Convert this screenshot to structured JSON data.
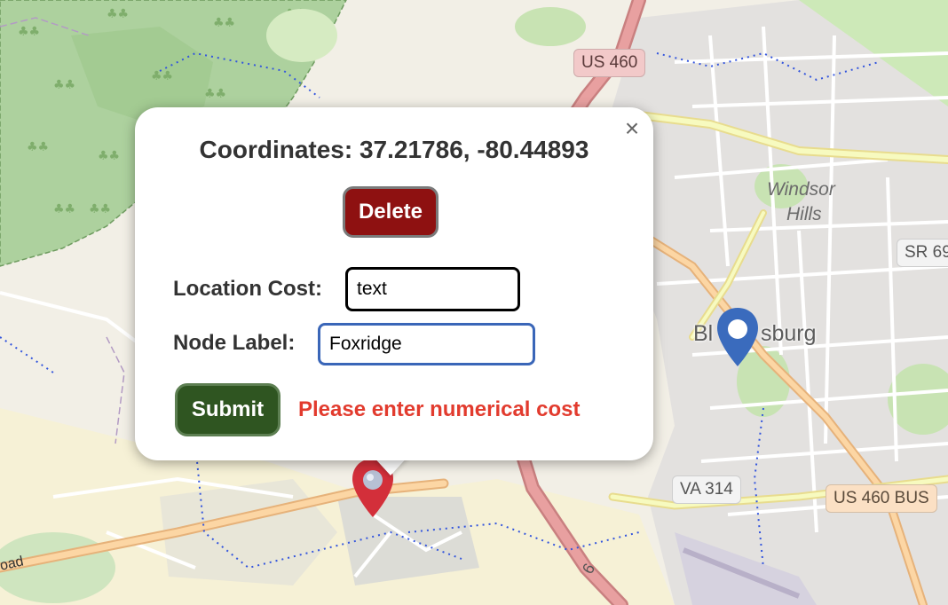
{
  "map": {
    "place_labels": {
      "windsor_hills_line1": "Windsor",
      "windsor_hills_line2": "Hills",
      "town_partial": "Bl",
      "town_partial2": "sburg",
      "road_fragment": "oad",
      "route_six": "6"
    },
    "shields": {
      "us460": "US 460",
      "sr": "SR 69",
      "va314": "VA 314",
      "us460bus": "US 460 BUS"
    },
    "colors": {
      "forest": "#add19e",
      "forest_border": "#6e9b5f",
      "urban": "#e0dfdf",
      "road_primary": "#fcd6a4",
      "road_trunk": "#e8a0a0",
      "road_minor": "#ffffff",
      "trail": "#3355dd",
      "marker_blue": "#3a6bbd",
      "marker_red": "#d32f3a"
    }
  },
  "popup": {
    "coordinates_text": "Coordinates: 37.21786, -80.44893",
    "close_symbol": "×",
    "delete_label": "Delete",
    "location_cost_label": "Location Cost:",
    "location_cost_value": "text",
    "node_label_label": "Node Label:",
    "node_label_value": "Foxridge",
    "submit_label": "Submit",
    "error_message": "Please enter numerical cost",
    "colors": {
      "delete_bg": "#8e1111",
      "submit_bg": "#2f5521",
      "error_text": "#e23b2e",
      "active_input_border": "#3a66b8"
    }
  },
  "markers": [
    {
      "name": "blue-map-marker",
      "color": "#3a6bbd",
      "icon": "map-pin-icon"
    },
    {
      "name": "red-map-marker",
      "color": "#d32f3a",
      "icon": "map-pin-icon"
    }
  ]
}
